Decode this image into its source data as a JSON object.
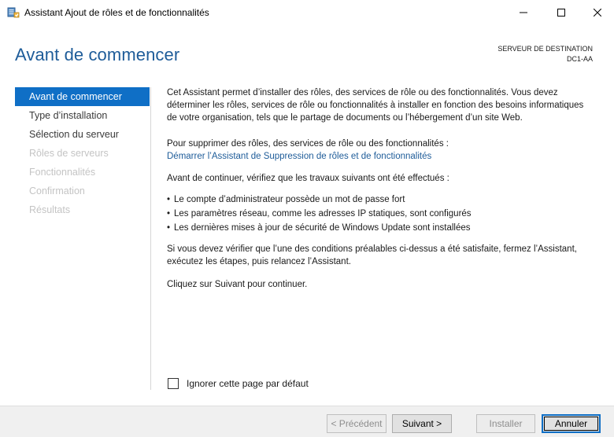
{
  "window": {
    "title": "Assistant Ajout de rôles et de fonctionnalités",
    "icon": "server-manager-icon"
  },
  "header": {
    "page_title": "Avant de commencer",
    "destination_label": "SERVEUR DE DESTINATION",
    "destination_server": "DC1-AA"
  },
  "nav": {
    "items": [
      {
        "label": "Avant de commencer",
        "state": "active"
      },
      {
        "label": "Type d’installation",
        "state": "enabled"
      },
      {
        "label": "Sélection du serveur",
        "state": "enabled"
      },
      {
        "label": "Rôles de serveurs",
        "state": "disabled"
      },
      {
        "label": "Fonctionnalités",
        "state": "disabled"
      },
      {
        "label": "Confirmation",
        "state": "disabled"
      },
      {
        "label": "Résultats",
        "state": "disabled"
      }
    ]
  },
  "content": {
    "intro": "Cet Assistant permet d’installer des rôles, des services de rôle ou des fonctionnalités. Vous devez déterminer les rôles, services de rôle ou fonctionnalités à installer en fonction des besoins informatiques de votre organisation, tels que le partage de documents ou l’hébergement d’un site Web.",
    "remove_text": "Pour supprimer des rôles, des services de rôle ou des fonctionnalités :",
    "remove_link": "Démarrer l’Assistant de Suppression de rôles et de fonctionnalités",
    "prereq_text": "Avant de continuer, vérifiez que les travaux suivants ont été effectués :",
    "bullets": [
      "Le compte d’administrateur possède un mot de passe fort",
      "Les paramètres réseau, comme les adresses IP statiques, sont configurés",
      "Les dernières mises à jour de sécurité de Windows Update sont installées"
    ],
    "verify_text": "Si vous devez vérifier que l’une des conditions préalables ci-dessus a été satisfaite, fermez l’Assistant, exécutez les étapes, puis relancez l’Assistant.",
    "next_text": "Cliquez sur Suivant pour continuer."
  },
  "skip_checkbox": {
    "label": "Ignorer cette page par défaut",
    "checked": false
  },
  "buttons": {
    "previous": "< Précédent",
    "next": "Suivant >",
    "install": "Installer",
    "cancel": "Annuler"
  },
  "colors": {
    "accent": "#0f6fc6",
    "title": "#1e5c99",
    "link": "#1e5c99",
    "disabled_text": "#c4c4c4"
  }
}
